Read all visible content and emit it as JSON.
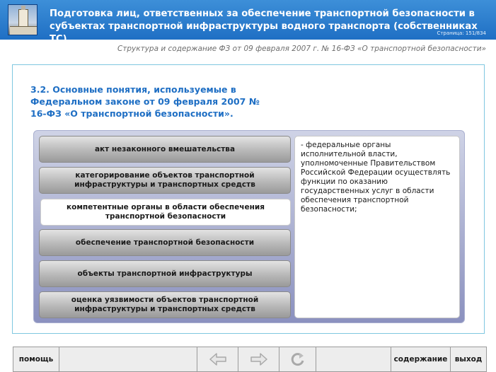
{
  "header": {
    "title": "Подготовка лиц, ответственных за обеспечение транспортной безопасности в субъектах транспортной инфраструктуры водного транспорта (собственниках ТС)",
    "page_counter": "Страница: 151/834",
    "logo_icon": "building-logo-icon"
  },
  "subheader": {
    "text": "Структура и содержание ФЗ от 09 февраля 2007 г. № 16-ФЗ «О транспортной безопасности»"
  },
  "section": {
    "title": "3.2. Основные понятия, используемые в Федеральном законе от 09 февраля 2007 № 16-ФЗ «О транспортной безопасности»."
  },
  "terms": [
    {
      "label": "акт незаконного вмешательства",
      "active": false
    },
    {
      "label": "категорирование объектов транспортной инфраструктуры и транспортных средств",
      "active": false
    },
    {
      "label": "компетентные органы в области обеспечения транспортной безопасности",
      "active": true
    },
    {
      "label": "обеспечение транспортной безопасности",
      "active": false
    },
    {
      "label": "объекты транспортной инфраструктуры",
      "active": false
    },
    {
      "label": "оценка уязвимости объектов транспортной инфраструктуры и транспортных средств",
      "active": false
    }
  ],
  "definition": {
    "text": "- федеральные органы исполнительной власти, уполномоченные Правительством Российской Федерации осуществлять функции по оказанию государственных услуг в области обеспечения транспортной безопасности;"
  },
  "footer": {
    "help_label": "помощь",
    "contents_label": "содержание",
    "exit_label": "выход",
    "back_icon": "arrow-left-icon",
    "forward_icon": "arrow-right-icon",
    "reload_icon": "reload-icon"
  }
}
